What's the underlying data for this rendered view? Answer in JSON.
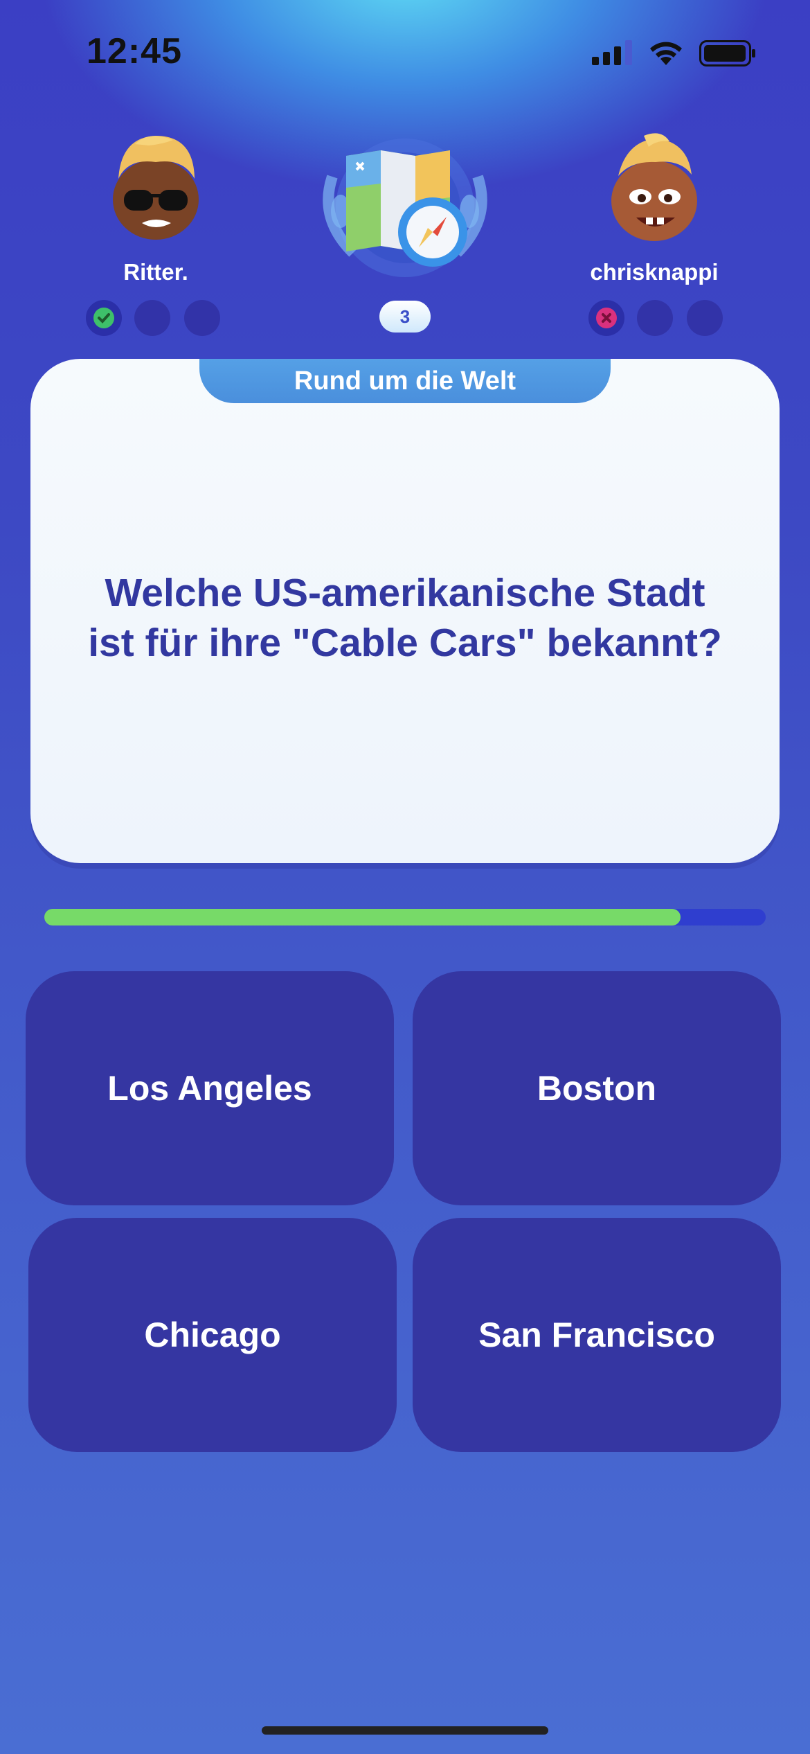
{
  "status_bar": {
    "time": "12:45"
  },
  "players": {
    "left": {
      "name": "Ritter.",
      "results": [
        "correct",
        "pending",
        "pending"
      ]
    },
    "right": {
      "name": "chrisknappi",
      "results": [
        "wrong",
        "pending",
        "pending"
      ]
    }
  },
  "round": {
    "number": "3"
  },
  "question": {
    "category": "Rund um die Welt",
    "text_line1": "Welche US-amerikanische Stadt",
    "text_line2": "ist für ihre \"Cable Cars\" bekannt?"
  },
  "timer": {
    "remaining_fraction": 0.882
  },
  "answers": [
    "Los Angeles",
    "Boston",
    "Chicago",
    "San Francisco"
  ],
  "colors": {
    "correct": "#3ec06a",
    "wrong": "#d9317e",
    "timer_fill": "#77da68"
  }
}
